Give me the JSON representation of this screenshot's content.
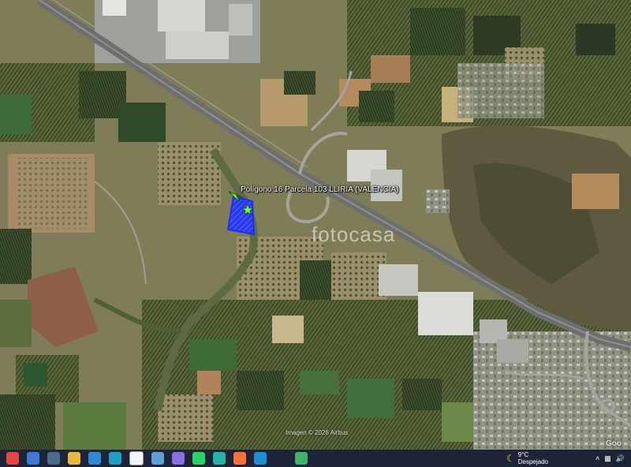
{
  "map": {
    "parcel_label": "Polígono 16 Parcela 103 LLIRIA (VALENCIA)",
    "watermark": "fotocasa",
    "attribution": "Imagen © 2026 Airbus",
    "brand": "Goo",
    "parcel_fill_color": "#2233ff",
    "highway_color": "#6e6e6e"
  },
  "taskbar": {
    "apps": [
      {
        "name": "chrome-icon",
        "color": "#e8453c"
      },
      {
        "name": "photo-viewer-icon",
        "color": "#3d7ad8"
      },
      {
        "name": "media-player-icon",
        "color": "#4f6b8a"
      },
      {
        "name": "file-explorer-icon",
        "color": "#e8b93c"
      },
      {
        "name": "photos-icon",
        "color": "#2f8bd6"
      },
      {
        "name": "edge-icon",
        "color": "#1fa0c6"
      },
      {
        "name": "document-icon",
        "color": "#f4f4f4"
      },
      {
        "name": "globe-icon",
        "color": "#5ea0d8"
      },
      {
        "name": "save-icon",
        "color": "#8a6fe0"
      },
      {
        "name": "whatsapp-icon",
        "color": "#25d366"
      },
      {
        "name": "c-app-icon",
        "color": "#21b5a8"
      },
      {
        "name": "firefox-icon",
        "color": "#ff7139"
      },
      {
        "name": "s-app-icon",
        "color": "#1a8fd8"
      },
      {
        "name": "a-app-icon",
        "color": "#1c2436"
      },
      {
        "name": "presentation-icon",
        "color": "#3fb26b"
      }
    ],
    "weather": {
      "temp": "9°C",
      "condition": "Despejado",
      "icon": "moon-icon"
    }
  }
}
